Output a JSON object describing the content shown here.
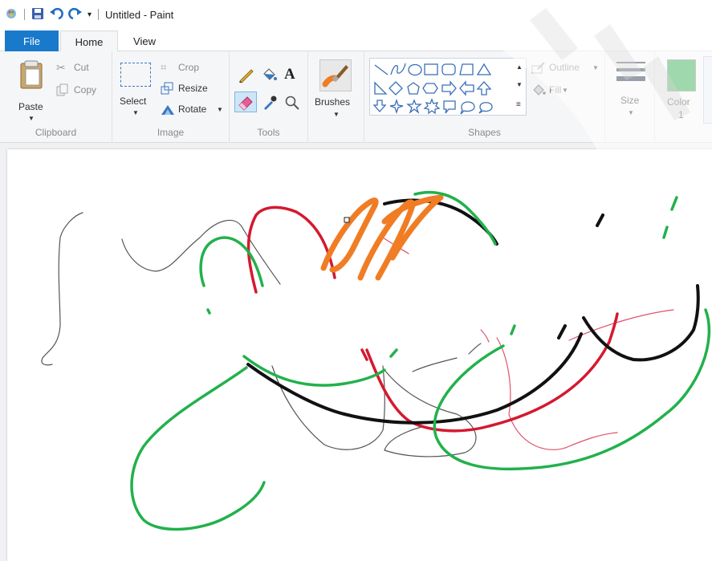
{
  "window": {
    "title": "Untitled - Paint"
  },
  "tabs": {
    "file": "File",
    "home": "Home",
    "view": "View"
  },
  "clipboard": {
    "paste": "Paste",
    "cut": "Cut",
    "copy": "Copy",
    "group": "Clipboard"
  },
  "image": {
    "select": "Select",
    "crop": "Crop",
    "resize": "Resize",
    "rotate": "Rotate",
    "group": "Image"
  },
  "tools": {
    "text_glyph": "A",
    "group": "Tools"
  },
  "brushes": {
    "label": "Brushes"
  },
  "shapes": {
    "outline": "Outline",
    "fill": "Fill",
    "group": "Shapes"
  },
  "size": {
    "label": "Size"
  },
  "color1": {
    "label": "Color",
    "number": "1",
    "swatch": "#2ea84a"
  },
  "colors": {
    "green": "#22b14c",
    "red": "#d4192f",
    "black": "#111111",
    "orange": "#f07c24",
    "thin": "#555555",
    "pink": "#e0506a"
  }
}
